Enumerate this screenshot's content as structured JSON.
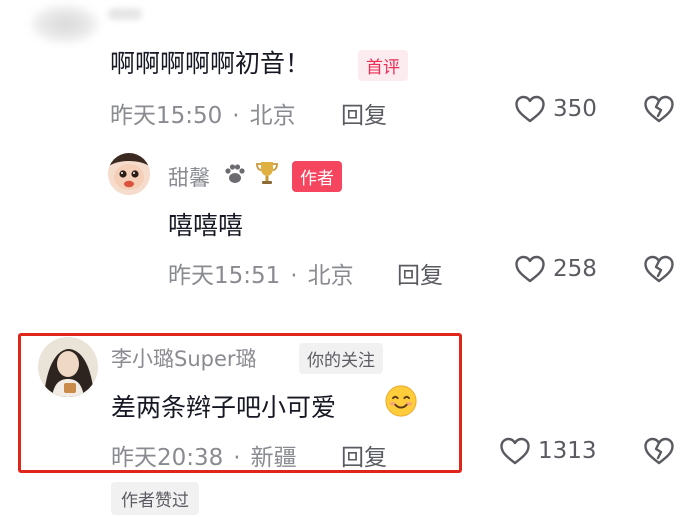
{
  "comments": [
    {
      "text": "啊啊啊啊啊初音！",
      "badge": "首评",
      "time": "昨天15:50",
      "location": "北京",
      "reply_label": "回复",
      "likes": "350",
      "liked": false
    },
    {
      "username": "甜馨",
      "badge": "作者",
      "text": "嘻嘻嘻",
      "time": "昨天15:51",
      "location": "北京",
      "reply_label": "回复",
      "likes": "258",
      "liked": false
    },
    {
      "username": "李小璐Super璐",
      "badge": "你的关注",
      "text": "差两条辫子吧小可爱",
      "time": "昨天20:38",
      "location": "新疆",
      "reply_label": "回复",
      "likes": "1313",
      "liked": false,
      "author_liked_label": "作者赞过"
    }
  ],
  "separator": "·",
  "icons": {
    "like": "heart-outline-icon",
    "dislike": "broken-heart-icon",
    "emoji": "smiling-face-emoji",
    "user_badges": [
      "paw-icon",
      "trophy-icon"
    ]
  },
  "colors": {
    "highlight_border": "#e0261b",
    "author_badge": "#f5455f",
    "first_badge_text": "#f02c55"
  }
}
